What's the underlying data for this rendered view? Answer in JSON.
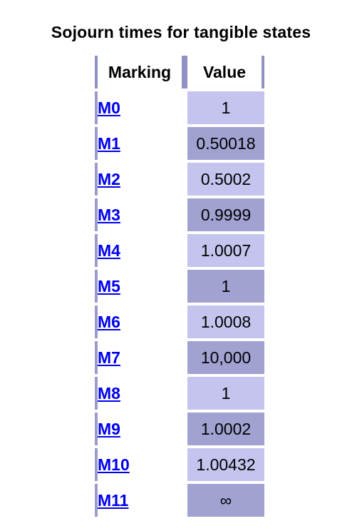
{
  "title": "Sojourn times for tangible states",
  "table": {
    "headers": {
      "marking": "Marking",
      "value": "Value"
    },
    "rows": [
      {
        "marking": "M0",
        "value": "1"
      },
      {
        "marking": "M1",
        "value": "0.50018"
      },
      {
        "marking": "M2",
        "value": "0.5002"
      },
      {
        "marking": "M3",
        "value": "0.9999"
      },
      {
        "marking": "M4",
        "value": "1.0007"
      },
      {
        "marking": "M5",
        "value": "1"
      },
      {
        "marking": "M6",
        "value": "1.0008"
      },
      {
        "marking": "M7",
        "value": "10,000"
      },
      {
        "marking": "M8",
        "value": "1"
      },
      {
        "marking": "M9",
        "value": "1.0002"
      },
      {
        "marking": "M10",
        "value": "1.00432"
      },
      {
        "marking": "M11",
        "value": "∞"
      }
    ]
  },
  "colors": {
    "row_light": "#c4c4ee",
    "row_dark": "#a1a1d2",
    "border": "#9090c4",
    "link": "#0000ee"
  }
}
